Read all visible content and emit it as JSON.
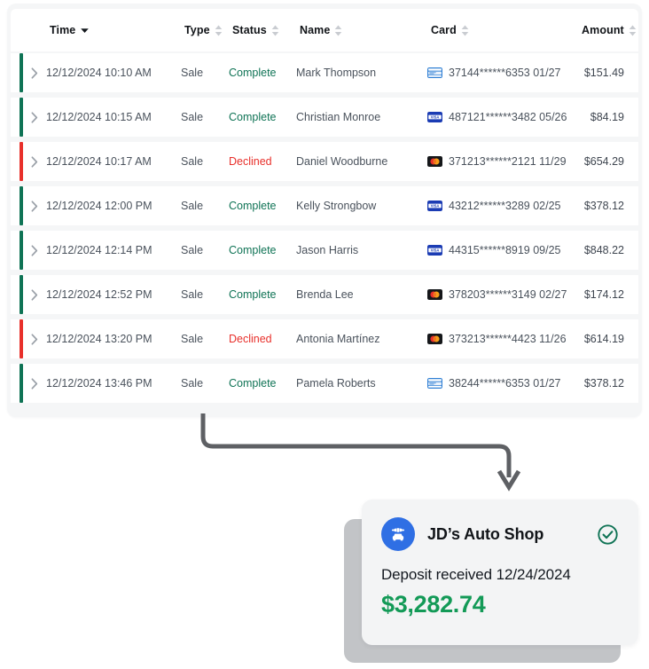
{
  "table": {
    "columns": [
      {
        "key": "time",
        "label": "Time",
        "sort": "desc-active",
        "align": "left"
      },
      {
        "key": "type",
        "label": "Type",
        "sort": "none",
        "align": "left"
      },
      {
        "key": "status",
        "label": "Status",
        "sort": "none",
        "align": "left"
      },
      {
        "key": "name",
        "label": "Name",
        "sort": "none",
        "align": "left"
      },
      {
        "key": "card",
        "label": "Card",
        "sort": "none",
        "align": "left"
      },
      {
        "key": "amount",
        "label": "Amount",
        "sort": "none",
        "align": "right"
      }
    ],
    "rows": [
      {
        "time": "12/12/2024 10:10 AM",
        "type": "Sale",
        "status": "Complete",
        "name": "Mark Thompson",
        "brand": "amex",
        "card": "37144******6353 01/27",
        "amount": "$151.49"
      },
      {
        "time": "12/12/2024 10:15 AM",
        "type": "Sale",
        "status": "Complete",
        "name": "Christian Monroe",
        "brand": "visa",
        "card": "487121******3482 05/26",
        "amount": "$84.19"
      },
      {
        "time": "12/12/2024 10:17 AM",
        "type": "Sale",
        "status": "Declined",
        "name": "Daniel Woodburne",
        "brand": "mastercard",
        "card": "371213******2121 11/29",
        "amount": "$654.29"
      },
      {
        "time": "12/12/2024 12:00 PM",
        "type": "Sale",
        "status": "Complete",
        "name": "Kelly Strongbow",
        "brand": "visa",
        "card": "43212******3289 02/25",
        "amount": "$378.12"
      },
      {
        "time": "12/12/2024 12:14 PM",
        "type": "Sale",
        "status": "Complete",
        "name": "Jason Harris",
        "brand": "visa",
        "card": "44315******8919 09/25",
        "amount": "$848.22"
      },
      {
        "time": "12/12/2024 12:52 PM",
        "type": "Sale",
        "status": "Complete",
        "name": "Brenda Lee",
        "brand": "mastercard",
        "card": "378203******3149 02/27",
        "amount": "$174.12"
      },
      {
        "time": "12/12/2024 13:20 PM",
        "type": "Sale",
        "status": "Declined",
        "name": "Antonia Martínez",
        "brand": "mastercard",
        "card": "373213******4423 11/26",
        "amount": "$614.19"
      },
      {
        "time": "12/12/2024 13:46 PM",
        "type": "Sale",
        "status": "Complete",
        "name": "Pamela Roberts",
        "brand": "amex",
        "card": "38244******6353 01/27",
        "amount": "$378.12"
      }
    ]
  },
  "deposit_card": {
    "merchant": "JD’s Auto Shop",
    "subtitle": "Deposit received 12/24/2024",
    "amount": "$3,282.74",
    "logo_icon": "car-repair-icon",
    "status_icon": "check-circle-icon"
  },
  "colors": {
    "status_complete": "#0f7355",
    "status_declined": "#e8302b",
    "amount_green": "#139a57",
    "logo_blue": "#2f6fe4",
    "arrow_gray": "#5e6064",
    "panel_bg": "#f5f6f7",
    "card_bg": "#f3f4f5",
    "ghost_card": "#c2c4c7"
  }
}
